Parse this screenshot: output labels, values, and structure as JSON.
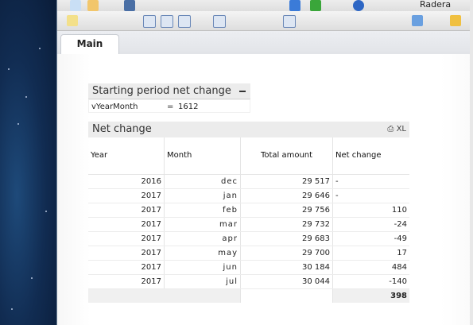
{
  "toolbar": {
    "user_label": "Radera"
  },
  "tabs": [
    {
      "label": "Main"
    }
  ],
  "starting_period": {
    "title": "Starting period net change",
    "variable": "vYearMonth",
    "equals": "=",
    "value": "1612"
  },
  "net_change": {
    "title": "Net change",
    "tools_label": "XL",
    "columns": [
      "Year",
      "Month",
      "Total amount",
      "Net change"
    ],
    "rows": [
      {
        "year": "2016",
        "month": "dec",
        "amount": "29 517",
        "change": "-"
      },
      {
        "year": "2017",
        "month": "jan",
        "amount": "29 646",
        "change": "-"
      },
      {
        "year": "2017",
        "month": "feb",
        "amount": "29 756",
        "change": "110"
      },
      {
        "year": "2017",
        "month": "mar",
        "amount": "29 732",
        "change": "-24"
      },
      {
        "year": "2017",
        "month": "apr",
        "amount": "29 683",
        "change": "-49"
      },
      {
        "year": "2017",
        "month": "may",
        "amount": "29 700",
        "change": "17"
      },
      {
        "year": "2017",
        "month": "jun",
        "amount": "30 184",
        "change": "484"
      },
      {
        "year": "2017",
        "month": "jul",
        "amount": "30 044",
        "change": "-140"
      }
    ],
    "total_change": "398"
  }
}
